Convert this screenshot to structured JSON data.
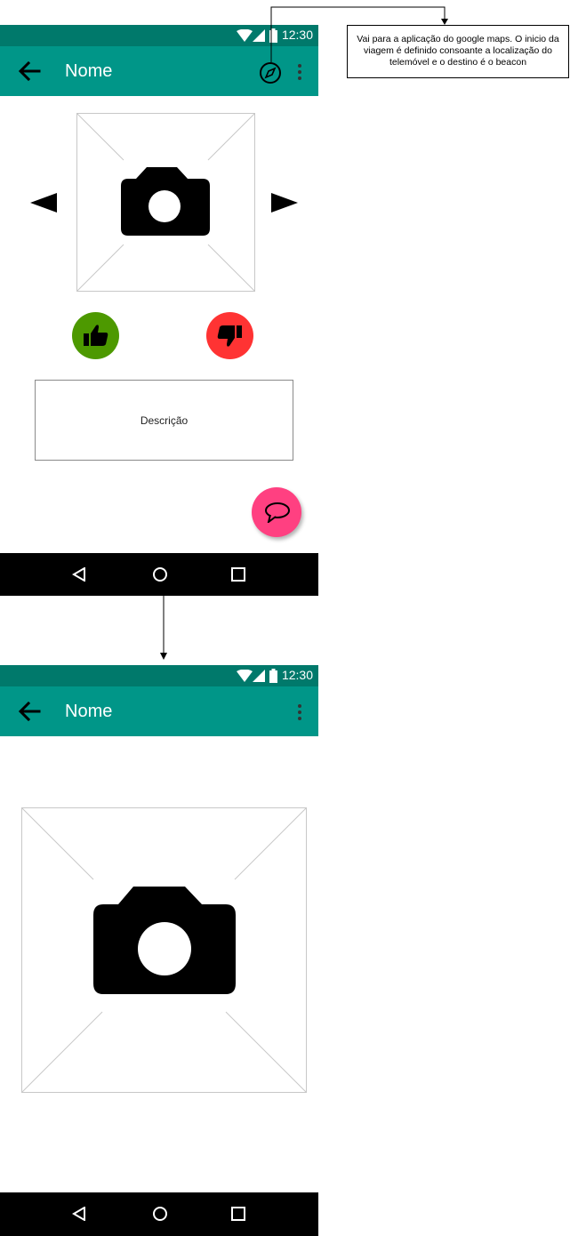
{
  "screen1": {
    "status_time": "12:30",
    "title": "Nome",
    "description_label": "Descrição"
  },
  "screen2": {
    "status_time": "12:30",
    "title": "Nome"
  },
  "annotation": {
    "text": "Vai para a aplicação do google maps. O inicio da viagem é definido consoante a localização do telemóvel e o destino é o beacon"
  },
  "colors": {
    "status_bar": "#00796b",
    "app_bar": "#009688",
    "like_button": "#4d9900",
    "dislike_button": "#ff3333",
    "chat_button": "#ff4081",
    "nav_bar": "#000000"
  },
  "icons": {
    "back": "back-arrow-icon",
    "navigate": "compass-icon",
    "menu": "more-vertical-icon",
    "photo": "camera-icon",
    "prev": "triangle-left-icon",
    "next": "triangle-right-icon",
    "like": "thumbs-up-icon",
    "dislike": "thumbs-down-icon",
    "chat": "chat-bubble-icon"
  }
}
